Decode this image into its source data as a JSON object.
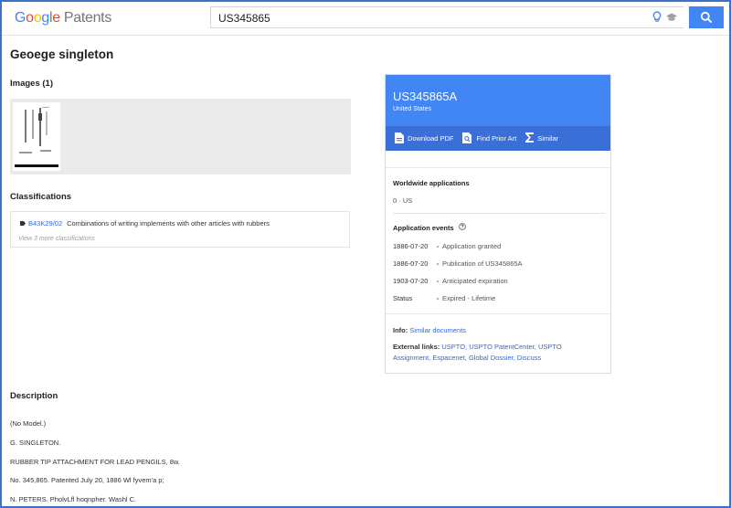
{
  "header": {
    "logo_letters": [
      "G",
      "o",
      "o",
      "g",
      "l",
      "e"
    ],
    "product": "Patents",
    "search_value": "US345865",
    "icons": [
      "lightbulb-icon",
      "graduation-cap-icon",
      "search-icon"
    ]
  },
  "patent": {
    "title": "Geoege singleton",
    "number": "US345865A",
    "country": "United States"
  },
  "images": {
    "heading": "Images (1)"
  },
  "classifications": {
    "heading": "Classifications",
    "code": "B43K29/02",
    "text": "Combinations of writing implements with other articles with rubbers",
    "more": "View 3 more classifications"
  },
  "actions": {
    "download_pdf": "Download PDF",
    "find_prior_art": "Find Prior Art",
    "similar": "Similar"
  },
  "worldwide": {
    "heading": "Worldwide applications",
    "value": "0 · US"
  },
  "events": {
    "heading": "Application events",
    "rows": [
      {
        "date": "1886-07-20",
        "text": "Application granted"
      },
      {
        "date": "1886-07-20",
        "text": "Publication of US345865A"
      },
      {
        "date": "1903-07-20",
        "text": "Anticipated expiration"
      },
      {
        "date": "Status",
        "text": "Expired - Lifetime"
      }
    ]
  },
  "info": {
    "label": "Info:",
    "similar_docs": "Similar documents",
    "external_label": "External links:",
    "links_line1": "USPTO, USPTO PatentCenter, USPTO",
    "links_line2": "Assignment, Espacenet, Global Dossier, Discuss"
  },
  "description": {
    "heading": "Description",
    "lines": [
      "(No Model.)",
      "G. SINGLETON.",
      "RUBBER TIP ATTACHMENT FOR LEAD PENGILS, 8w.",
      "No. 345,865. Patented July 20, 1886 Wl fyvem'a p;",
      "N. PETERS. PholvLfl hoqnpher. Washl C."
    ]
  },
  "colors": {
    "accent": "#4285f4",
    "action_bar": "#3b6fd8",
    "link": "#3367d6",
    "frame": "#3b73c9"
  }
}
